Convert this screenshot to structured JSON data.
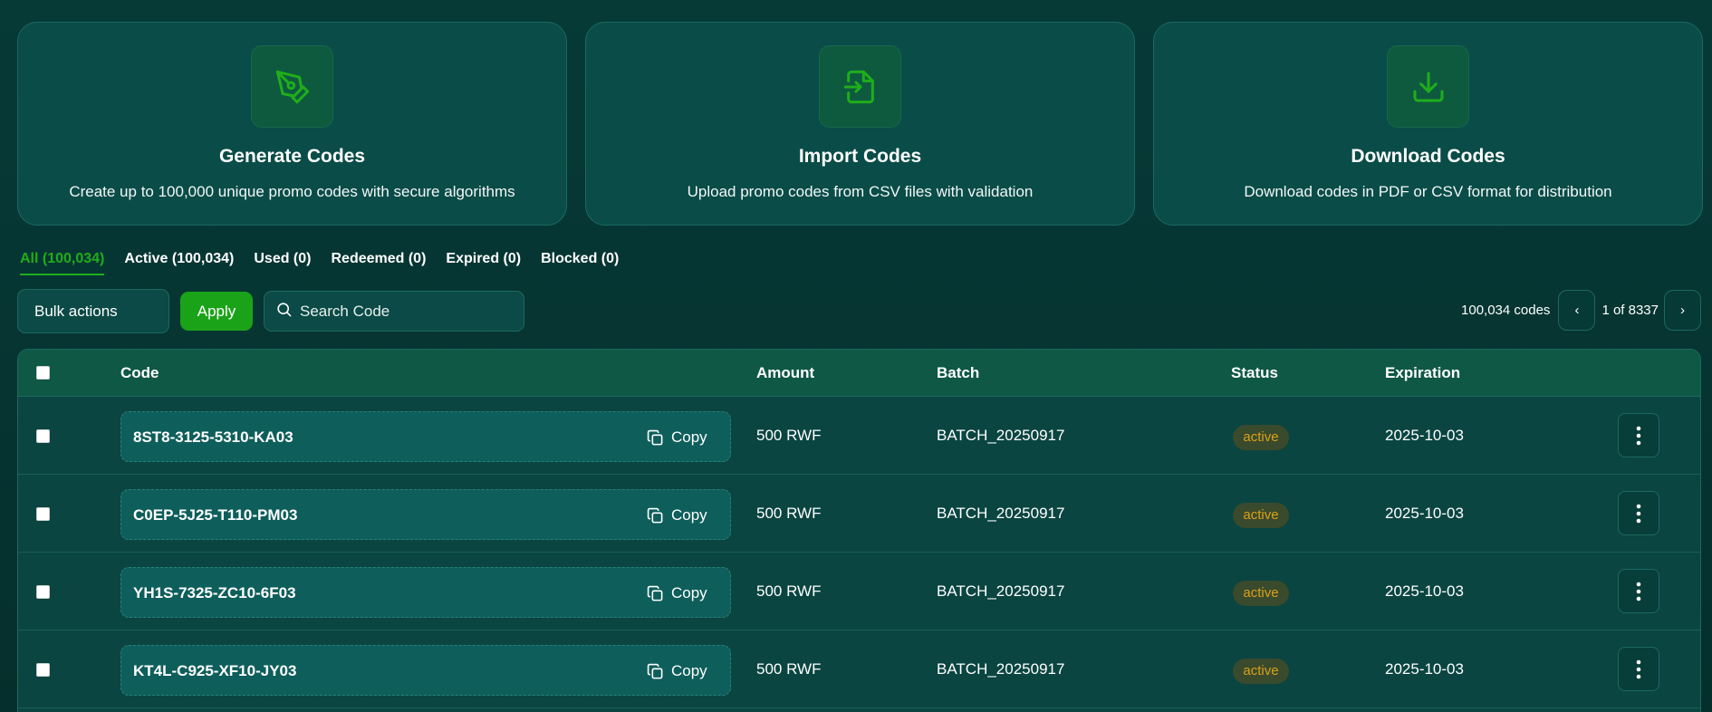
{
  "cards": [
    {
      "title": "Generate Codes",
      "description": "Create up to 100,000 unique promo codes with secure algorithms",
      "icon": "pen-tool-icon"
    },
    {
      "title": "Import Codes",
      "description": "Upload promo codes from CSV files with validation",
      "icon": "file-import-icon"
    },
    {
      "title": "Download Codes",
      "description": "Download codes in PDF or CSV format for distribution",
      "icon": "download-icon"
    }
  ],
  "tabs": [
    {
      "label": "All (100,034)",
      "active": true
    },
    {
      "label": "Active (100,034)",
      "active": false
    },
    {
      "label": "Used (0)",
      "active": false
    },
    {
      "label": "Redeemed (0)",
      "active": false
    },
    {
      "label": "Expired (0)",
      "active": false
    },
    {
      "label": "Blocked (0)",
      "active": false
    }
  ],
  "toolbar": {
    "bulk_label": "Bulk actions",
    "apply_label": "Apply",
    "search_placeholder": "Search Code"
  },
  "pagination": {
    "count_label": "100,034 codes",
    "page_label": "1  of 8337",
    "prev": "‹",
    "next": "›"
  },
  "table": {
    "headers": {
      "code": "Code",
      "amount": "Amount",
      "batch": "Batch",
      "status": "Status",
      "expiration": "Expiration"
    },
    "copy_label": "Copy",
    "rows": [
      {
        "code": "8ST8-3125-5310-KA03",
        "amount": "500 RWF",
        "batch": "BATCH_20250917",
        "status": "active",
        "expiration": "2025-10-03"
      },
      {
        "code": "C0EP-5J25-T110-PM03",
        "amount": "500 RWF",
        "batch": "BATCH_20250917",
        "status": "active",
        "expiration": "2025-10-03"
      },
      {
        "code": "YH1S-7325-ZC10-6F03",
        "amount": "500 RWF",
        "batch": "BATCH_20250917",
        "status": "active",
        "expiration": "2025-10-03"
      },
      {
        "code": "KT4L-C925-XF10-JY03",
        "amount": "500 RWF",
        "batch": "BATCH_20250917",
        "status": "active",
        "expiration": "2025-10-03"
      }
    ]
  },
  "colors": {
    "accent": "#1aa319",
    "status_active": "#d9a11a",
    "card_bg": "#0a4c48"
  }
}
